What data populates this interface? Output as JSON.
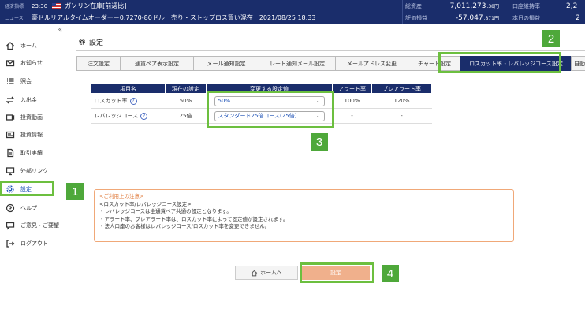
{
  "topbar": {
    "row1": {
      "label": "経済指標",
      "time": "23:30",
      "text": "ガソリン在庫[前週比]"
    },
    "row2": {
      "label": "ニュース",
      "text": "豪ドルリアルタイムオーダー＝0.7270-80ドル　売り・ストップロス買い混在　2021/08/25 18:33"
    },
    "total_assets_label": "総資産",
    "total_assets_value": "7,011,273",
    "total_assets_unit": ".38円",
    "eval_label": "評価損益",
    "eval_value": "-57,047",
    "eval_unit": ".871円",
    "margin_rate_label": "口座維持率",
    "margin_rate_value": "2,2",
    "today_pl_label": "本日の損益",
    "today_pl_value": "2"
  },
  "sidebar": {
    "collapse": "«",
    "items": [
      {
        "label": "ホーム",
        "icon": "home-icon"
      },
      {
        "label": "お知らせ",
        "icon": "mail-icon"
      },
      {
        "label": "照会",
        "icon": "list-icon"
      },
      {
        "label": "入出金",
        "icon": "transfer-icon"
      },
      {
        "label": "投資動画",
        "icon": "video-icon"
      },
      {
        "label": "投資情報",
        "icon": "news-icon"
      },
      {
        "label": "取引実績",
        "icon": "document-icon"
      },
      {
        "label": "外部リンク",
        "icon": "monitor-icon"
      },
      {
        "label": "設定",
        "icon": "gear-icon"
      },
      {
        "label": "ヘルプ",
        "icon": "help-icon"
      },
      {
        "label": "ご意見・ご要望",
        "icon": "feedback-icon"
      },
      {
        "label": "ログアウト",
        "icon": "logout-icon"
      }
    ]
  },
  "main": {
    "title": "設定",
    "tabs": [
      "注文設定",
      "通貨ペア表示設定",
      "メール通知設定",
      "レート通知メール設定",
      "メールアドレス変更",
      "チャート設定",
      "ロスカット率・レバレッジコース設定",
      "自動ロ"
    ],
    "table": {
      "headers": [
        "項目名",
        "現在の設定",
        "変更する設定値",
        "アラート率",
        "プレアラート率"
      ],
      "rows": [
        {
          "name": "ロスカット率",
          "current": "50%",
          "select": "50%",
          "alert": "100%",
          "prealert": "120%"
        },
        {
          "name": "レバレッジコース",
          "current": "25倍",
          "select": "スタンダード25倍コース(25倍)",
          "alert": "-",
          "prealert": "-"
        }
      ]
    },
    "notice": {
      "title": "<ご利用上の注意>",
      "lines": [
        "<ロスカット率/レバレッジコース設定>",
        "・レバレッジコースは全通貨ペア共通の設定となります。",
        "・アラート率、プレアラート率は、ロスカット率によって固定値が設定されます。",
        "・法人口座のお客様はレバレッジコース/ロスカット率を変更できません。"
      ]
    },
    "home_button": "ホームへ",
    "set_button": "設定"
  },
  "annotations": [
    "1",
    "2",
    "3",
    "4"
  ],
  "colors": {
    "navy": "#1a2d6b",
    "highlight": "#6cbf3f",
    "badge": "#4ea83a",
    "notice_border": "#f0a878",
    "set_button": "#f0b08c"
  }
}
